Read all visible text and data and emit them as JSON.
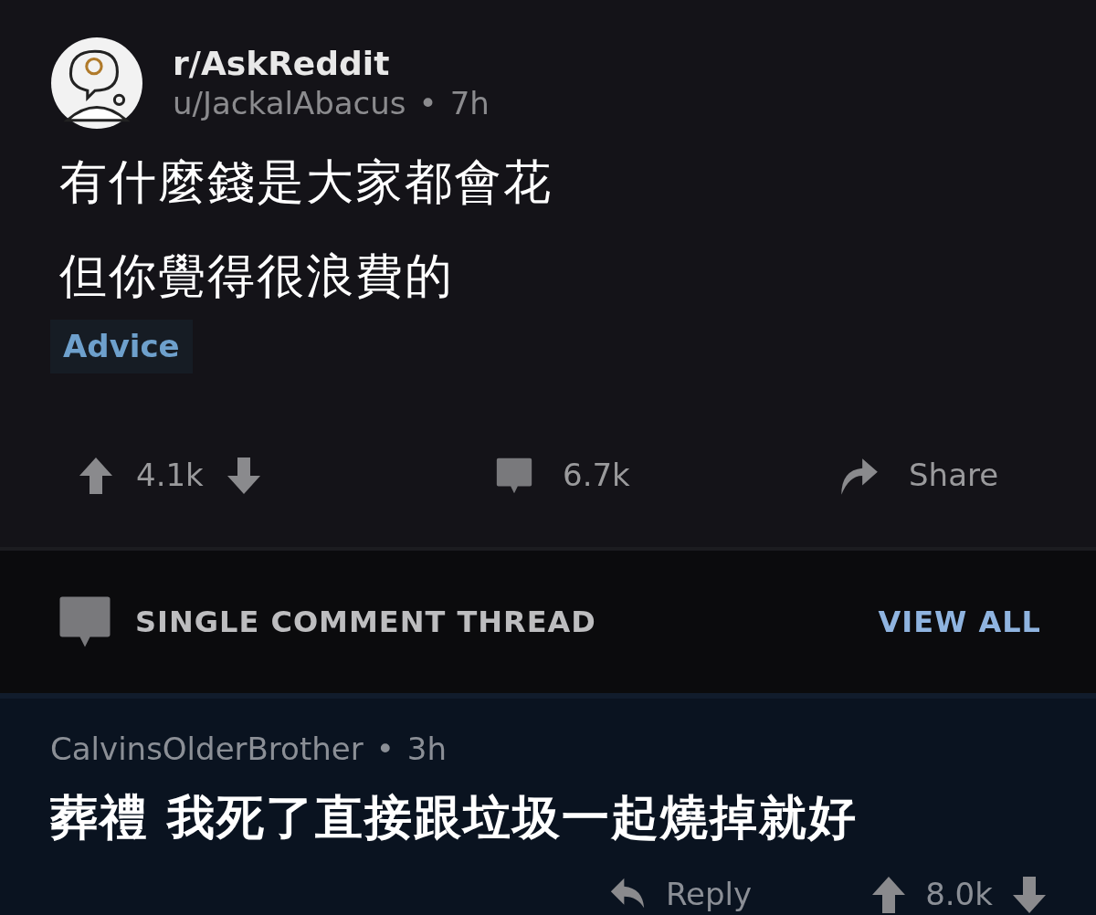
{
  "post": {
    "subreddit": "r/AskReddit",
    "author": "u/JackalAbacus",
    "separator": "•",
    "age": "7h",
    "title_lines": [
      "有什麼錢是大家都會花",
      "但你覺得很浪費的"
    ],
    "flair": "Advice"
  },
  "actions": {
    "upvotes": "4.1k",
    "comments": "6.7k",
    "share": "Share"
  },
  "thread_bar": {
    "label": "SINGLE COMMENT THREAD",
    "link": "VIEW ALL"
  },
  "comment": {
    "author": "CalvinsOlderBrother",
    "separator": "•",
    "age": "3h",
    "body": "葬禮 我死了直接跟垃圾一起燒掉就好",
    "reply": "Reply",
    "votes": "8.0k"
  }
}
